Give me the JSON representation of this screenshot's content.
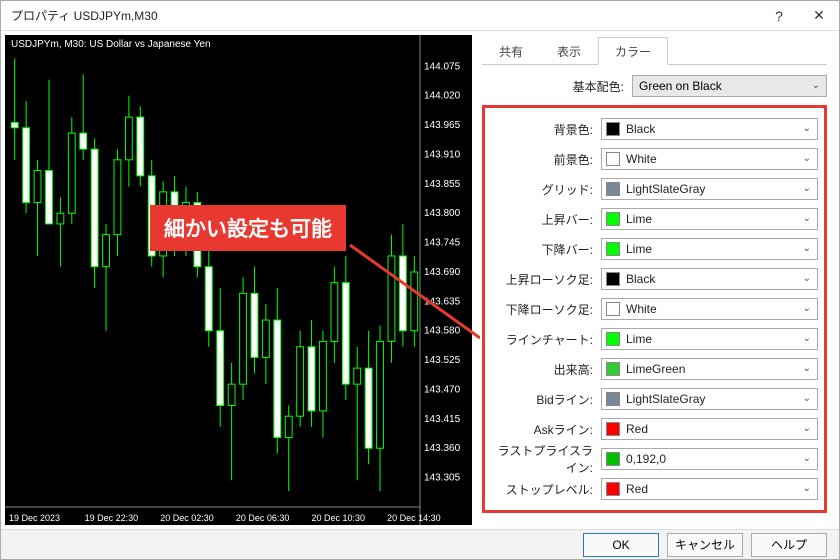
{
  "window": {
    "title": "プロパティ USDJPYm,M30"
  },
  "chart": {
    "header_text": "USDJPYm, M30:  US Dollar vs Japanese Yen",
    "annotation_text": "細かい設定も可能",
    "y_ticks": [
      "144.075",
      "144.020",
      "143.965",
      "143.910",
      "143.855",
      "143.800",
      "143.745",
      "143.690",
      "143.635",
      "143.580",
      "143.525",
      "143.470",
      "143.415",
      "143.360",
      "143.305"
    ],
    "x_ticks": [
      "19 Dec 2023",
      "19 Dec 22:30",
      "20 Dec 02:30",
      "20 Dec 06:30",
      "20 Dec 10:30",
      "20 Dec 14:30"
    ]
  },
  "tabs": {
    "t1": "共有",
    "t2": "表示",
    "t3": "カラー"
  },
  "scheme": {
    "label": "基本配色:",
    "value": "Green on Black"
  },
  "color_rows": [
    {
      "label": "背景色:",
      "name": "Black",
      "color": "#000000"
    },
    {
      "label": "前景色:",
      "name": "White",
      "color": "#ffffff"
    },
    {
      "label": "グリッド:",
      "name": "LightSlateGray",
      "color": "#778899"
    },
    {
      "label": "上昇バー:",
      "name": "Lime",
      "color": "#00ff00"
    },
    {
      "label": "下降バー:",
      "name": "Lime",
      "color": "#00ff00"
    },
    {
      "label": "上昇ローソク足:",
      "name": "Black",
      "color": "#000000"
    },
    {
      "label": "下降ローソク足:",
      "name": "White",
      "color": "#ffffff"
    },
    {
      "label": "ラインチャート:",
      "name": "Lime",
      "color": "#00ff00"
    },
    {
      "label": "出来高:",
      "name": "LimeGreen",
      "color": "#32cd32"
    },
    {
      "label": "Bidライン:",
      "name": "LightSlateGray",
      "color": "#778899"
    },
    {
      "label": "Askライン:",
      "name": "Red",
      "color": "#ff0000"
    },
    {
      "label": "ラストプライスライン:",
      "name": "0,192,0",
      "color": "#00c000"
    },
    {
      "label": "ストップレベル:",
      "name": "Red",
      "color": "#ff0000"
    }
  ],
  "footer": {
    "ok": "OK",
    "cancel": "キャンセル",
    "help": "ヘルプ"
  },
  "chart_data": {
    "type": "candlestick",
    "symbol": "USDJPYm",
    "timeframe": "M30",
    "title": "US Dollar vs Japanese Yen",
    "ylim": [
      143.25,
      144.1
    ],
    "x_labels": [
      "19 Dec 2023",
      "19 Dec 22:30",
      "20 Dec 02:30",
      "20 Dec 06:30",
      "20 Dec 10:30",
      "20 Dec 14:30"
    ],
    "candles": [
      {
        "i": 0,
        "o": 143.97,
        "h": 144.09,
        "l": 143.9,
        "c": 143.96
      },
      {
        "i": 1,
        "o": 143.96,
        "h": 144.01,
        "l": 143.8,
        "c": 143.82
      },
      {
        "i": 2,
        "o": 143.82,
        "h": 143.9,
        "l": 143.72,
        "c": 143.88
      },
      {
        "i": 3,
        "o": 143.88,
        "h": 144.05,
        "l": 143.85,
        "c": 143.78
      },
      {
        "i": 4,
        "o": 143.78,
        "h": 143.83,
        "l": 143.7,
        "c": 143.8
      },
      {
        "i": 5,
        "o": 143.8,
        "h": 143.98,
        "l": 143.78,
        "c": 143.95
      },
      {
        "i": 6,
        "o": 143.95,
        "h": 144.06,
        "l": 143.9,
        "c": 143.92
      },
      {
        "i": 7,
        "o": 143.92,
        "h": 143.94,
        "l": 143.66,
        "c": 143.7
      },
      {
        "i": 8,
        "o": 143.7,
        "h": 143.78,
        "l": 143.58,
        "c": 143.76
      },
      {
        "i": 9,
        "o": 143.76,
        "h": 143.92,
        "l": 143.72,
        "c": 143.9
      },
      {
        "i": 10,
        "o": 143.9,
        "h": 144.02,
        "l": 143.85,
        "c": 143.98
      },
      {
        "i": 11,
        "o": 143.98,
        "h": 144.0,
        "l": 143.85,
        "c": 143.87
      },
      {
        "i": 12,
        "o": 143.87,
        "h": 143.9,
        "l": 143.7,
        "c": 143.72
      },
      {
        "i": 13,
        "o": 143.72,
        "h": 143.86,
        "l": 143.68,
        "c": 143.84
      },
      {
        "i": 14,
        "o": 143.84,
        "h": 143.87,
        "l": 143.72,
        "c": 143.75
      },
      {
        "i": 15,
        "o": 143.75,
        "h": 143.85,
        "l": 143.72,
        "c": 143.82
      },
      {
        "i": 16,
        "o": 143.82,
        "h": 143.84,
        "l": 143.68,
        "c": 143.7
      },
      {
        "i": 17,
        "o": 143.7,
        "h": 143.74,
        "l": 143.55,
        "c": 143.58
      },
      {
        "i": 18,
        "o": 143.58,
        "h": 143.66,
        "l": 143.4,
        "c": 143.44
      },
      {
        "i": 19,
        "o": 143.44,
        "h": 143.52,
        "l": 143.3,
        "c": 143.48
      },
      {
        "i": 20,
        "o": 143.48,
        "h": 143.68,
        "l": 143.45,
        "c": 143.65
      },
      {
        "i": 21,
        "o": 143.65,
        "h": 143.7,
        "l": 143.5,
        "c": 143.53
      },
      {
        "i": 22,
        "o": 143.53,
        "h": 143.63,
        "l": 143.48,
        "c": 143.6
      },
      {
        "i": 23,
        "o": 143.6,
        "h": 143.66,
        "l": 143.35,
        "c": 143.38
      },
      {
        "i": 24,
        "o": 143.38,
        "h": 143.44,
        "l": 143.28,
        "c": 143.42
      },
      {
        "i": 25,
        "o": 143.42,
        "h": 143.58,
        "l": 143.4,
        "c": 143.55
      },
      {
        "i": 26,
        "o": 143.55,
        "h": 143.6,
        "l": 143.4,
        "c": 143.43
      },
      {
        "i": 27,
        "o": 143.43,
        "h": 143.58,
        "l": 143.38,
        "c": 143.56
      },
      {
        "i": 28,
        "o": 143.56,
        "h": 143.7,
        "l": 143.52,
        "c": 143.67
      },
      {
        "i": 29,
        "o": 143.67,
        "h": 143.72,
        "l": 143.45,
        "c": 143.48
      },
      {
        "i": 30,
        "o": 143.48,
        "h": 143.55,
        "l": 143.3,
        "c": 143.51
      },
      {
        "i": 31,
        "o": 143.51,
        "h": 143.58,
        "l": 143.33,
        "c": 143.36
      },
      {
        "i": 32,
        "o": 143.36,
        "h": 143.59,
        "l": 143.28,
        "c": 143.56
      },
      {
        "i": 33,
        "o": 143.56,
        "h": 143.76,
        "l": 143.52,
        "c": 143.72
      },
      {
        "i": 34,
        "o": 143.72,
        "h": 143.78,
        "l": 143.55,
        "c": 143.58
      },
      {
        "i": 35,
        "o": 143.58,
        "h": 143.72,
        "l": 143.55,
        "c": 143.69
      }
    ]
  }
}
